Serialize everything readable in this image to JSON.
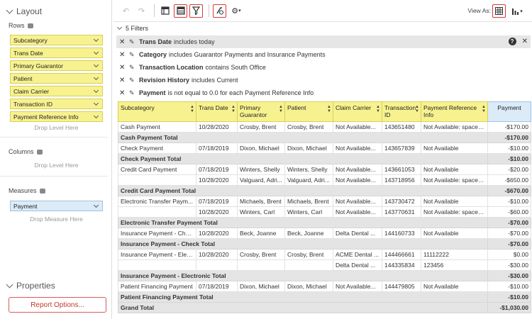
{
  "layout": {
    "title": "Layout"
  },
  "rows": {
    "label": "Rows",
    "items": [
      "Subcategory",
      "Trans Date",
      "Primary Guarantor",
      "Patient",
      "Claim Carrier",
      "Transaction ID",
      "Payment Reference Info"
    ],
    "drop": "Drop Level Here"
  },
  "columns": {
    "label": "Columns",
    "drop": "Drop Level Here"
  },
  "measures": {
    "label": "Measures",
    "items": [
      "Payment"
    ],
    "drop": "Drop Measure Here"
  },
  "properties": {
    "title": "Properties",
    "report_button": "Report Options..."
  },
  "toolbar": {
    "view_as": "View As:"
  },
  "filters": {
    "toggle": "5 Filters",
    "items": [
      {
        "field": "Trans Date",
        "text": "includes today"
      },
      {
        "field": "Category",
        "text": "includes Guarantor Payments and Insurance Payments"
      },
      {
        "field": "Transaction Location",
        "text": "contains South Office"
      },
      {
        "field": "Revision History",
        "text": "includes Current"
      },
      {
        "field": "Payment",
        "text": "is not equal to 0.0 for each Payment Reference Info"
      }
    ]
  },
  "grid": {
    "headers": [
      "Subcategory",
      "Trans Date",
      "Primary Guarantor",
      "Patient",
      "Claim Carrier",
      "Transaction ID",
      "Payment Reference Info",
      "Payment"
    ],
    "rows": [
      {
        "type": "data",
        "cells": [
          "Cash Payment",
          "10/28/2020",
          "Crosby, Brent",
          "Crosby, Brent",
          "Not Available...",
          "143651480",
          "Not Available: spaces ...",
          "-$170.00"
        ]
      },
      {
        "type": "total",
        "label": "Cash Payment Total",
        "value": "-$170.00"
      },
      {
        "type": "data",
        "cells": [
          "Check Payment",
          "07/18/2019",
          "Dixon, Michael",
          "Dixon, Michael",
          "Not Available...",
          "143657839",
          "Not Available",
          "-$10.00"
        ]
      },
      {
        "type": "total",
        "label": "Check Payment Total",
        "value": "-$10.00"
      },
      {
        "type": "data",
        "cells": [
          "Credit Card Payment",
          "07/18/2019",
          "Winters, Shelly",
          "Winters, Shelly",
          "Not Available...",
          "143661053",
          "Not Available",
          "-$20.00"
        ]
      },
      {
        "type": "data",
        "cells": [
          "",
          "10/28/2020",
          "Valguard, Adri...",
          "Valguard, Adri...",
          "Not Available...",
          "143718956",
          "Not Available: spaces ...",
          "-$650.00"
        ]
      },
      {
        "type": "total",
        "label": "Credit Card Payment Total",
        "value": "-$670.00"
      },
      {
        "type": "data",
        "cells": [
          "Electronic Transfer Paym...",
          "07/18/2019",
          "Michaels, Brent",
          "Michaels, Brent",
          "Not Available...",
          "143730472",
          "Not Available",
          "-$10.00"
        ]
      },
      {
        "type": "data",
        "cells": [
          "",
          "10/28/2020",
          "Winters, Carl",
          "Winters, Carl",
          "Not Available...",
          "143770631",
          "Not Available: spaces ...",
          "-$60.00"
        ]
      },
      {
        "type": "total",
        "label": "Electronic Transfer Payment Total",
        "value": "-$70.00"
      },
      {
        "type": "data",
        "cells": [
          "Insurance Payment - Check",
          "10/28/2020",
          "Beck, Joanne",
          "Beck, Joanne",
          "Delta Dental ...",
          "144160733",
          "Not Available",
          "-$70.00"
        ]
      },
      {
        "type": "total",
        "label": "Insurance Payment - Check Total",
        "value": "-$70.00"
      },
      {
        "type": "data",
        "cells": [
          "Insurance Payment - Elec...",
          "10/28/2020",
          "Crosby, Brent",
          "Crosby, Brent",
          "ACME Dental ...",
          "144466661",
          "11112222",
          "$0.00"
        ]
      },
      {
        "type": "data",
        "cells": [
          "",
          "",
          "",
          "",
          "Delta Dental ...",
          "144335834",
          "123456",
          "-$30.00"
        ]
      },
      {
        "type": "total",
        "label": "Insurance Payment - Electronic Total",
        "value": "-$30.00"
      },
      {
        "type": "data",
        "cells": [
          "Patient Financing Payment",
          "07/18/2019",
          "Dixon, Michael",
          "Dixon, Michael",
          "Not Available...",
          "144479805",
          "Not Available",
          "-$10.00"
        ]
      },
      {
        "type": "total",
        "label": "Patient Financing Payment Total",
        "value": "-$10.00"
      },
      {
        "type": "total",
        "label": "Grand Total",
        "value": "-$1,030.00"
      }
    ]
  }
}
